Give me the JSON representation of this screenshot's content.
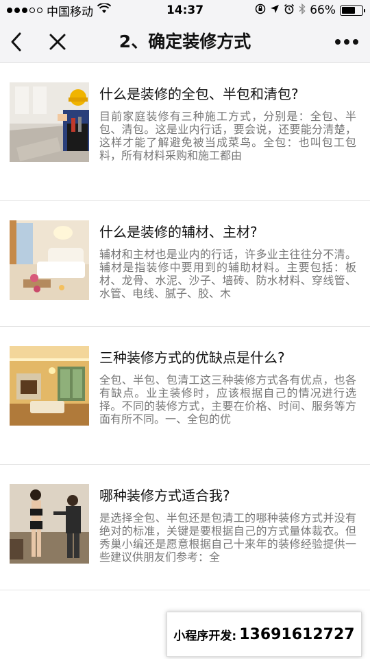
{
  "status_bar": {
    "carrier": "中国移动",
    "time": "14:37",
    "battery_percent": "66%",
    "battery_level": 0.66,
    "signal_bars_filled": 3,
    "signal_bars_total": 5
  },
  "nav": {
    "title": "2、确定装修方式",
    "back_icon": "chevron-left-icon",
    "close_icon": "close-icon",
    "more_icon": "more-dots-icon"
  },
  "articles": [
    {
      "title": "什么是装修的全包、半包和清包?",
      "desc": "目前家庭装修有三种施工方式，分别是：全包、半包、清包。这是业内行话，要会说，还要能分清楚，这样才能了解避免被当成菜鸟。全包：也叫包工包料，所有材料采购和施工都由",
      "image": "worker-with-tools-photo"
    },
    {
      "title": "什么是装修的辅材、主材?",
      "desc": "辅材和主材也是业内的行话，许多业主往往分不清。辅材是指装修中要用到的辅助材料。主要包括：板材、龙骨、水泥、沙子、墙砖、防水材料、穿线管、水管、电线、腻子、胶、木",
      "image": "living-room-photo"
    },
    {
      "title": "三种装修方式的优缺点是什么?",
      "desc": "全包、半包、包清工这三种装修方式各有优点，也各有缺点。业主装修时，应该根据自己的情况进行选择。不同的装修方式，主要在价格、时间、服务等方面有所不同。一、全包的优",
      "image": "european-interior-photo"
    },
    {
      "title": "哪种装修方式适合我?",
      "desc": "是选择全包、半包还是包清工的哪种装修方式并没有绝对的标准，关键是要根据自己的方式量体裁衣。但秀巢小编还是愿意根据自己十来年的装修经验提供一些建议供朋友们参考：全",
      "image": "tailor-fitting-photo"
    }
  ],
  "contact": {
    "label": "小程序开发:",
    "number": "13691612727"
  },
  "colors": {
    "nav_background": "#f4f4f6",
    "title_text": "#111111",
    "desc_text": "#777777",
    "divider": "#e2e2e2"
  }
}
